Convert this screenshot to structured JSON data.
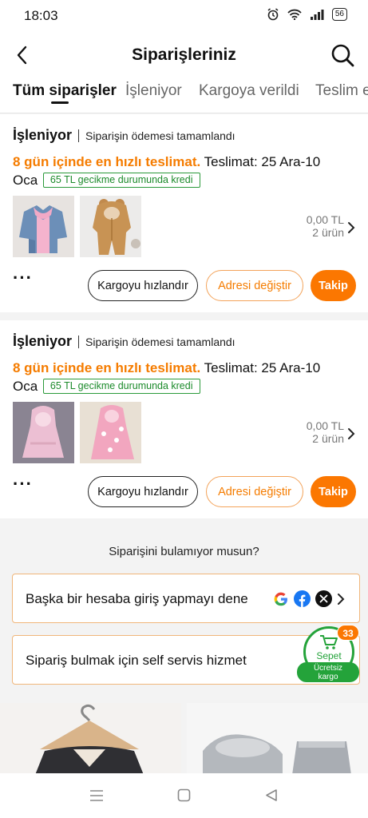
{
  "status_bar": {
    "time": "18:03",
    "battery": "56"
  },
  "header": {
    "title": "Siparişleriniz"
  },
  "tabs": [
    {
      "label": "Tüm siparişler"
    },
    {
      "label": "İşleniyor"
    },
    {
      "label": "Kargoya verildi"
    },
    {
      "label": "Teslim e"
    }
  ],
  "orders": [
    {
      "status": "İşleniyor",
      "payment_status": "Siparişin ödemesi tamamlandı",
      "delivery_fast": "8 gün içinde en hızlı teslimat.",
      "delivery_date": "Teslimat: 25 Ara-10 Oca",
      "credit_badge": "65 TL gecikme durumunda kredi",
      "price": "0,00 TL",
      "item_count": "2 ürün",
      "buttons": {
        "speed": "Kargoyu hızlandır",
        "address": "Adresi değiştir",
        "track": "Takip"
      }
    },
    {
      "status": "İşleniyor",
      "payment_status": "Siparişin ödemesi tamamlandı",
      "delivery_fast": "8 gün içinde en hızlı teslimat.",
      "delivery_date": "Teslimat: 25 Ara-10 Oca",
      "credit_badge": "65 TL gecikme durumunda kredi",
      "price": "0,00 TL",
      "item_count": "2 ürün",
      "buttons": {
        "speed": "Kargoyu hızlandır",
        "address": "Adresi değiştir",
        "track": "Takip"
      }
    }
  ],
  "help": {
    "question": "Siparişini bulamıyor musun?",
    "other_account": "Başka bir hesaba giriş yapmayı dene",
    "self_service": "Sipariş bulmak için self servis hizmet"
  },
  "cart": {
    "label": "Sepet",
    "count": "33",
    "free_shipping_1": "Ücretsiz",
    "free_shipping_2": "kargo"
  },
  "colors": {
    "accent": "#fb7701",
    "green": "#24a33a"
  }
}
